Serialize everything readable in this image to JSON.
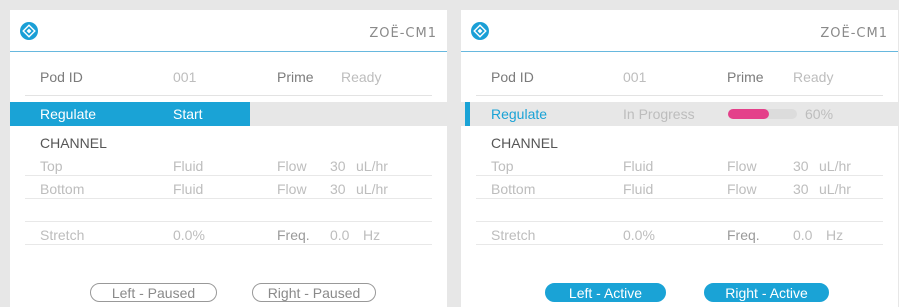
{
  "colors": {
    "accent": "#1aa3d6",
    "progress": "#e4408a",
    "background": "#e7e7e7"
  },
  "panels": [
    {
      "model": "ZOË-CM1",
      "pod_label": "Pod ID",
      "pod_value": "001",
      "prime_label": "Prime",
      "prime_value": "Ready",
      "regulate_label": "Regulate",
      "regulate_value": "Start",
      "channel_label": "CHANNEL",
      "top_label": "Top",
      "top_value": "Fluid",
      "top_flow_label": "Flow",
      "top_flow_value": "30",
      "top_flow_unit": "uL/hr",
      "bottom_label": "Bottom",
      "bottom_value": "Fluid",
      "bottom_flow_label": "Flow",
      "bottom_flow_value": "30",
      "bottom_flow_unit": "uL/hr",
      "stretch_label": "Stretch",
      "stretch_value": "0.0%",
      "freq_label": "Freq.",
      "freq_value": "0.0",
      "freq_unit": "Hz",
      "left_button": "Left - Paused",
      "right_button": "Right - Paused"
    },
    {
      "model": "ZOË-CM1",
      "pod_label": "Pod ID",
      "pod_value": "001",
      "prime_label": "Prime",
      "prime_value": "Ready",
      "regulate_label": "Regulate",
      "regulate_value": "In Progress",
      "progress_fraction": 0.6,
      "progress_text": "60%",
      "channel_label": "CHANNEL",
      "top_label": "Top",
      "top_value": "Fluid",
      "top_flow_label": "Flow",
      "top_flow_value": "30",
      "top_flow_unit": "uL/hr",
      "bottom_label": "Bottom",
      "bottom_value": "Fluid",
      "bottom_flow_label": "Flow",
      "bottom_flow_value": "30",
      "bottom_flow_unit": "uL/hr",
      "stretch_label": "Stretch",
      "stretch_value": "0.0%",
      "freq_label": "Freq.",
      "freq_value": "0.0",
      "freq_unit": "Hz",
      "left_button": "Left - Active",
      "right_button": "Right - Active"
    }
  ]
}
